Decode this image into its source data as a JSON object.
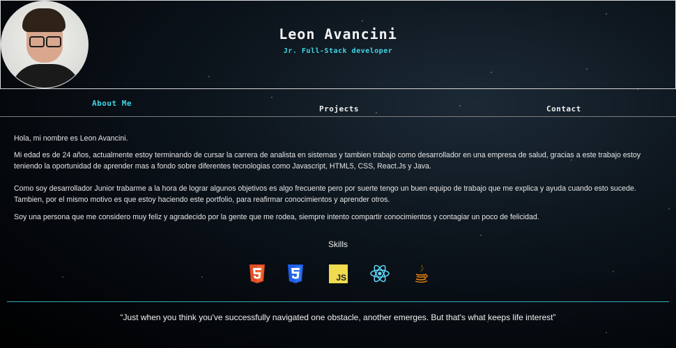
{
  "header": {
    "name": "Leon Avancini",
    "role": "Jr. Full-Stack developer"
  },
  "nav": {
    "items": [
      {
        "label": "About Me",
        "active": true
      },
      {
        "label": "Projects",
        "active": false
      },
      {
        "label": "Contact",
        "active": false
      }
    ]
  },
  "about": {
    "paragraphs": [
      "Hola, mi nombre es Leon Avancini.",
      "Mi edad es de 24 años, actualmente estoy terminando de cursar la carrera de analista en sistemas y tambien trabajo como desarrollador en una empresa de salud, gracias a este trabajo estoy teniendo la oportunidad de aprender mas a fondo sobre diferentes tecnologias como Javascript, HTML5, CSS, React.Js y Java.",
      "Como soy desarrollador Junior trabarme a la hora de lograr algunos objetivos es algo frecuente pero por suerte tengo un buen equipo de trabajo que me explica y ayuda cuando esto sucede. Tambien, por el mismo motivo es que estoy haciendo este portfolio, para reafirmar conocimientos y aprender otros.",
      "Soy una persona que me considero muy feliz y agradecido por la gente que me rodea, siempre intento compartir conocimientos y contagiar un poco de felicidad."
    ]
  },
  "skills": {
    "title": "Skills",
    "icons": [
      "html5-icon",
      "css3-icon",
      "javascript-icon",
      "react-icon",
      "java-icon"
    ],
    "js_label": "JS"
  },
  "quote": "“Just when you think you've successfully navigated one obstacle, another emerges. But that's what keeps life interest”",
  "colors": {
    "accent": "#3fd6e6",
    "html5": "#e44d26",
    "css3": "#1f5fe6",
    "javascript": "#f0db4f",
    "react": "#61dafb",
    "java": "#e8820c"
  }
}
